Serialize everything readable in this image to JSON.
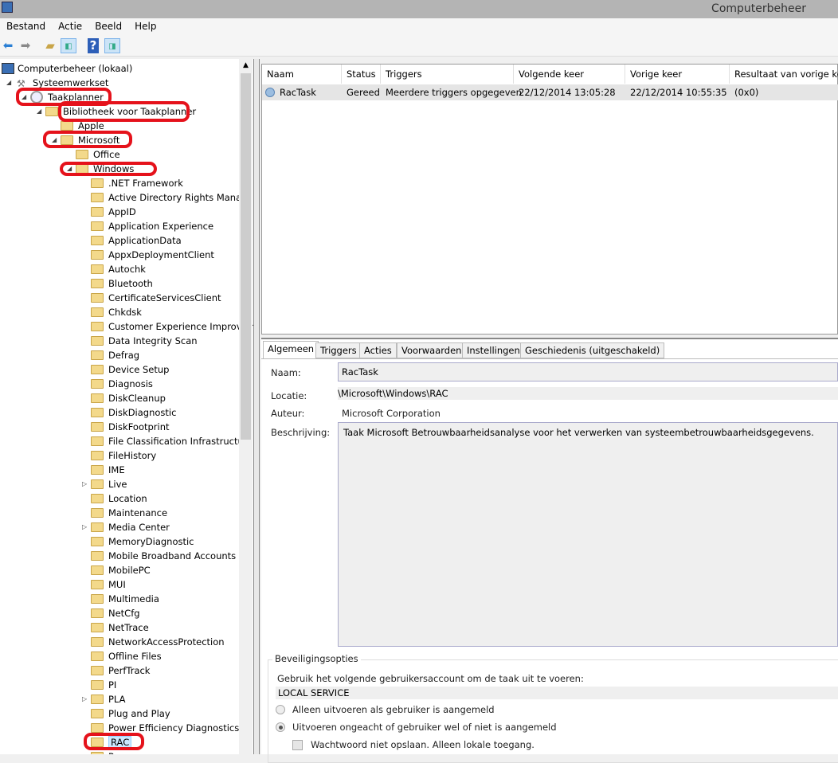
{
  "window": {
    "title": "Computerbeheer"
  },
  "menu": [
    "Bestand",
    "Actie",
    "Beeld",
    "Help"
  ],
  "toolbar": {
    "icons": [
      "back-arrow-icon",
      "forward-arrow-icon",
      "up-folder-icon",
      "show-hide-console-tree-icon",
      "help-icon",
      "show-hide-action-pane-icon"
    ],
    "help_glyph": "?"
  },
  "tree": {
    "root": "Computerbeheer (lokaal)",
    "systeemwerkset": "Systeemwerkset",
    "taakplanner": "Taakplanner",
    "bibliotheek": "Bibliotheek voor Taakplanner",
    "apple": "Apple",
    "microsoft": "Microsoft",
    "office": "Office",
    "windows": "Windows",
    "windows_children": [
      ".NET Framework",
      "Active Directory Rights Management",
      "AppID",
      "Application Experience",
      "ApplicationData",
      "AppxDeploymentClient",
      "Autochk",
      "Bluetooth",
      "CertificateServicesClient",
      "Chkdsk",
      "Customer Experience Improvement",
      "Data Integrity Scan",
      "Defrag",
      "Device Setup",
      "Diagnosis",
      "DiskCleanup",
      "DiskDiagnostic",
      "DiskFootprint",
      "File Classification Infrastructure",
      "FileHistory",
      "IME",
      "Live",
      "Location",
      "Maintenance",
      "Media Center",
      "MemoryDiagnostic",
      "Mobile Broadband Accounts",
      "MobilePC",
      "MUI",
      "Multimedia",
      "NetCfg",
      "NetTrace",
      "NetworkAccessProtection",
      "Offline Files",
      "PerfTrack",
      "PI",
      "PLA",
      "Plug and Play",
      "Power Efficiency Diagnostics",
      "RAC",
      "Ra"
    ],
    "expandable": [
      "Live",
      "Media Center",
      "PLA"
    ],
    "selected": "RAC"
  },
  "tasklist": {
    "columns": [
      "Naam",
      "Status",
      "Triggers",
      "Volgende keer uitvoeren",
      "Vorige keer uitgevoerd",
      "Resultaat van vorige keer"
    ],
    "rows": [
      {
        "name": "RacTask",
        "status": "Gereed",
        "triggers": "Meerdere triggers opgegeven",
        "next": "22/12/2014 13:05:28",
        "last": "22/12/2014 10:55:35",
        "result": "(0x0)"
      }
    ]
  },
  "details": {
    "tabs": [
      "Algemeen",
      "Triggers",
      "Acties",
      "Voorwaarden",
      "Instellingen",
      "Geschiedenis (uitgeschakeld)"
    ],
    "naam_label": "Naam:",
    "naam": "RacTask",
    "locatie_label": "Locatie:",
    "locatie": "\\Microsoft\\Windows\\RAC",
    "auteur_label": "Auteur:",
    "auteur": "Microsoft Corporation",
    "beschrijving_label": "Beschrijving:",
    "beschrijving": "Taak Microsoft Betrouwbaarheidsanalyse voor het verwerken van systeembetrouwbaarheidsgegevens.",
    "security": {
      "title": "Beveiligingsopties",
      "account_label": "Gebruik het volgende gebruikersaccount om de taak uit te voeren:",
      "account": "LOCAL SERVICE",
      "radio1": "Alleen uitvoeren als gebruiker is aangemeld",
      "radio2": "Uitvoeren ongeacht of gebruiker wel of niet is aangemeld",
      "selected_radio": 2,
      "checkbox": "Wachtwoord niet opslaan. Alleen lokale toegang.",
      "checkbox_checked": false
    }
  },
  "annotation_color": "#e5121b"
}
